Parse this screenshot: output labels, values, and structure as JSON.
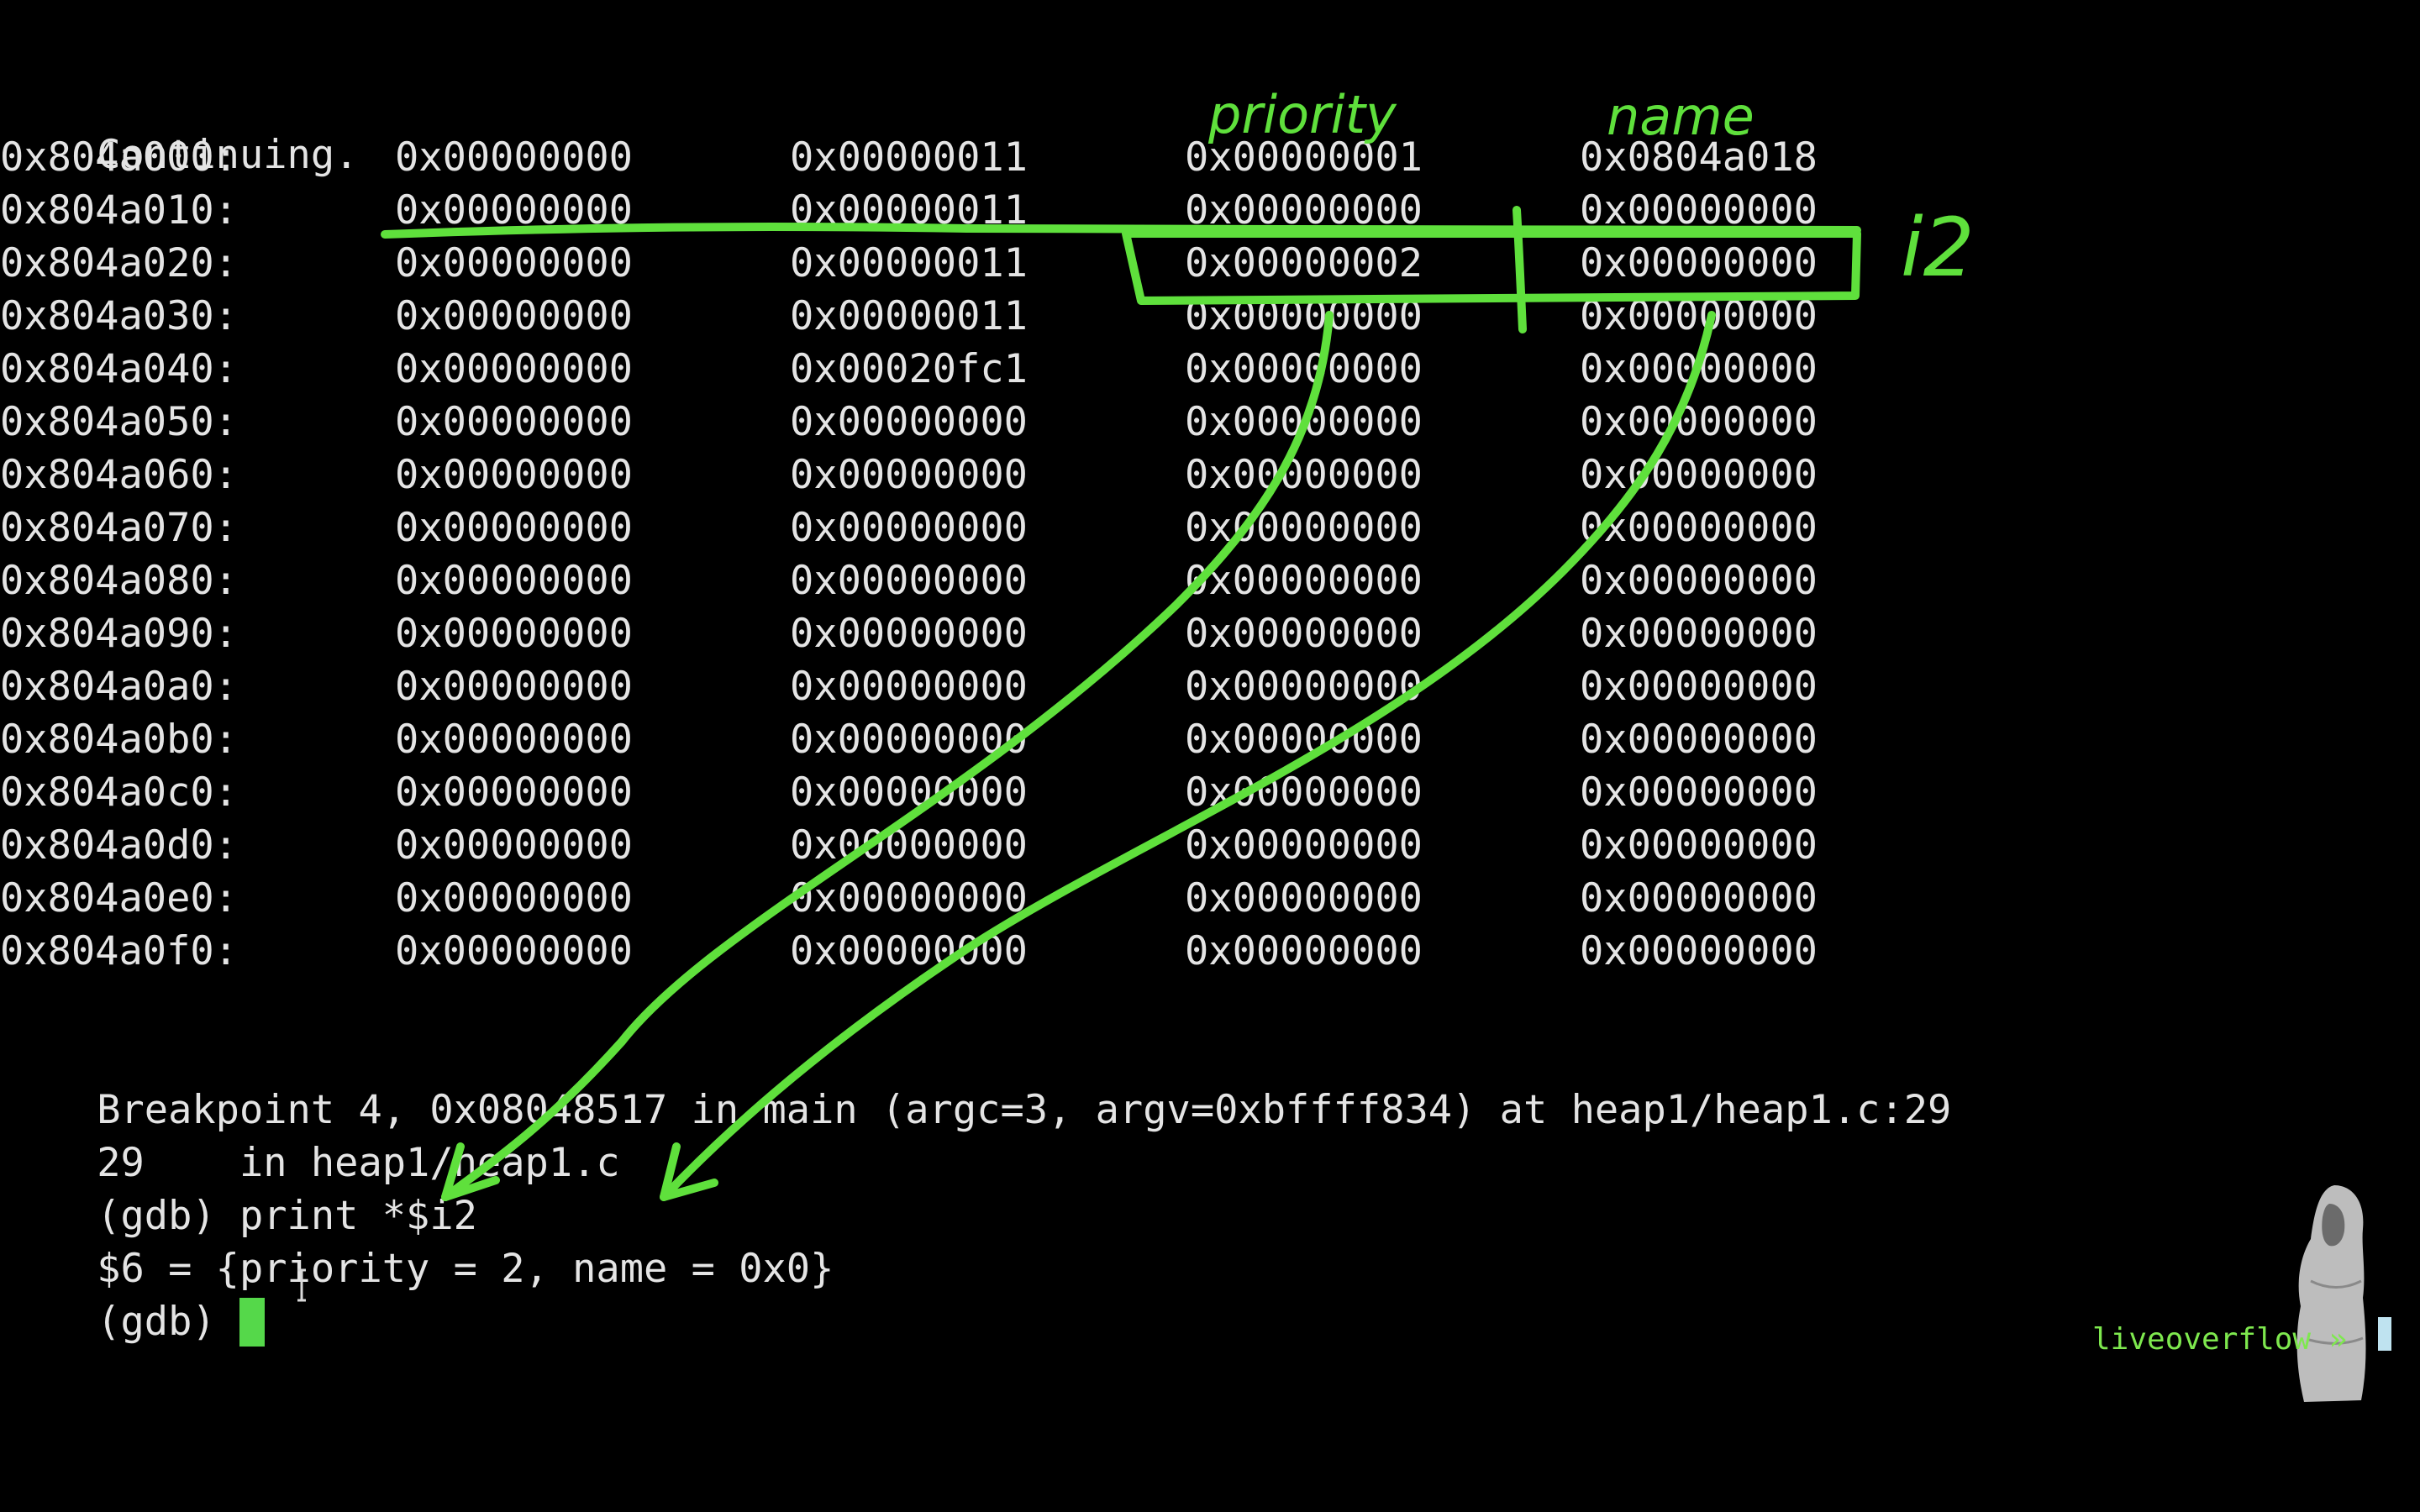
{
  "terminal": {
    "continuing": "Continuing.",
    "rows": [
      {
        "addr": "0x804a000:",
        "w": [
          "0x00000000",
          "0x00000011",
          "0x00000001",
          "0x0804a018"
        ]
      },
      {
        "addr": "0x804a010:",
        "w": [
          "0x00000000",
          "0x00000011",
          "0x00000000",
          "0x00000000"
        ]
      },
      {
        "addr": "0x804a020:",
        "w": [
          "0x00000000",
          "0x00000011",
          "0x00000002",
          "0x00000000"
        ]
      },
      {
        "addr": "0x804a030:",
        "w": [
          "0x00000000",
          "0x00000011",
          "0x00000000",
          "0x00000000"
        ]
      },
      {
        "addr": "0x804a040:",
        "w": [
          "0x00000000",
          "0x00020fc1",
          "0x00000000",
          "0x00000000"
        ]
      },
      {
        "addr": "0x804a050:",
        "w": [
          "0x00000000",
          "0x00000000",
          "0x00000000",
          "0x00000000"
        ]
      },
      {
        "addr": "0x804a060:",
        "w": [
          "0x00000000",
          "0x00000000",
          "0x00000000",
          "0x00000000"
        ]
      },
      {
        "addr": "0x804a070:",
        "w": [
          "0x00000000",
          "0x00000000",
          "0x00000000",
          "0x00000000"
        ]
      },
      {
        "addr": "0x804a080:",
        "w": [
          "0x00000000",
          "0x00000000",
          "0x00000000",
          "0x00000000"
        ]
      },
      {
        "addr": "0x804a090:",
        "w": [
          "0x00000000",
          "0x00000000",
          "0x00000000",
          "0x00000000"
        ]
      },
      {
        "addr": "0x804a0a0:",
        "w": [
          "0x00000000",
          "0x00000000",
          "0x00000000",
          "0x00000000"
        ]
      },
      {
        "addr": "0x804a0b0:",
        "w": [
          "0x00000000",
          "0x00000000",
          "0x00000000",
          "0x00000000"
        ]
      },
      {
        "addr": "0x804a0c0:",
        "w": [
          "0x00000000",
          "0x00000000",
          "0x00000000",
          "0x00000000"
        ]
      },
      {
        "addr": "0x804a0d0:",
        "w": [
          "0x00000000",
          "0x00000000",
          "0x00000000",
          "0x00000000"
        ]
      },
      {
        "addr": "0x804a0e0:",
        "w": [
          "0x00000000",
          "0x00000000",
          "0x00000000",
          "0x00000000"
        ]
      },
      {
        "addr": "0x804a0f0:",
        "w": [
          "0x00000000",
          "0x00000000",
          "0x00000000",
          "0x00000000"
        ]
      }
    ],
    "breakpoint_line": "Breakpoint 4, 0x08048517 in main (argc=3, argv=0xbffff834) at heap1/heap1.c:29",
    "source_line": "29\t  in heap1/heap1.c",
    "command_line": "(gdb) print *$i2",
    "result_line": "$6 = {priority = 2, name = 0x0}",
    "prompt": "(gdb) "
  },
  "annotations": {
    "label_priority": "priority",
    "label_name": "name",
    "label_i2": "i2",
    "color": "#5fe03c"
  },
  "branding": {
    "text": "liveoverflow »"
  },
  "colors": {
    "background": "#000000",
    "text": "#e4e4e4",
    "cursor": "#55d84a",
    "brand": "#7ee84e"
  }
}
